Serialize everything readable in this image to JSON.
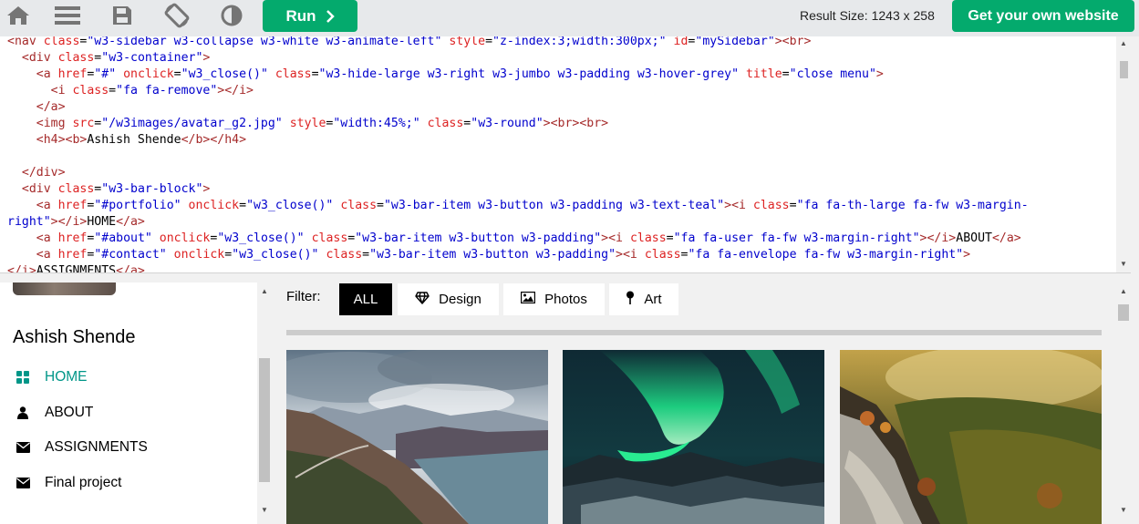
{
  "toolbar": {
    "icons": [
      "home-icon",
      "menu-icon",
      "save-icon",
      "rotate-icon",
      "theme-contrast-icon"
    ],
    "run_label": "Run",
    "result_size": "Result Size: 1243 x 258",
    "get_website_label": "Get your own website"
  },
  "code_lines": [
    [
      {
        "t": "tg",
        "v": "<nav "
      },
      {
        "t": "at",
        "v": "class"
      },
      {
        "t": "tx",
        "v": "="
      },
      {
        "t": "vl",
        "v": "\"w3-sidebar w3-collapse w3-white w3-animate-left\""
      },
      {
        "t": "tx",
        "v": " "
      },
      {
        "t": "at",
        "v": "style"
      },
      {
        "t": "tx",
        "v": "="
      },
      {
        "t": "vl",
        "v": "\"z-index:3;width:300px;\""
      },
      {
        "t": "tx",
        "v": " "
      },
      {
        "t": "at",
        "v": "id"
      },
      {
        "t": "tx",
        "v": "="
      },
      {
        "t": "vl",
        "v": "\"mySidebar\""
      },
      {
        "t": "tg",
        "v": "><br>"
      }
    ],
    [
      {
        "t": "tx",
        "v": "  "
      },
      {
        "t": "tg",
        "v": "<div "
      },
      {
        "t": "at",
        "v": "class"
      },
      {
        "t": "tx",
        "v": "="
      },
      {
        "t": "vl",
        "v": "\"w3-container\""
      },
      {
        "t": "tg",
        "v": ">"
      }
    ],
    [
      {
        "t": "tx",
        "v": "    "
      },
      {
        "t": "tg",
        "v": "<a "
      },
      {
        "t": "at",
        "v": "href"
      },
      {
        "t": "tx",
        "v": "="
      },
      {
        "t": "vl",
        "v": "\"#\""
      },
      {
        "t": "tx",
        "v": " "
      },
      {
        "t": "at",
        "v": "onclick"
      },
      {
        "t": "tx",
        "v": "="
      },
      {
        "t": "vl",
        "v": "\"w3_close()\""
      },
      {
        "t": "tx",
        "v": " "
      },
      {
        "t": "at",
        "v": "class"
      },
      {
        "t": "tx",
        "v": "="
      },
      {
        "t": "vl",
        "v": "\"w3-hide-large w3-right w3-jumbo w3-padding w3-hover-grey\""
      },
      {
        "t": "tx",
        "v": " "
      },
      {
        "t": "at",
        "v": "title"
      },
      {
        "t": "tx",
        "v": "="
      },
      {
        "t": "vl",
        "v": "\"close menu\""
      },
      {
        "t": "tg",
        "v": ">"
      }
    ],
    [
      {
        "t": "tx",
        "v": "      "
      },
      {
        "t": "tg",
        "v": "<i "
      },
      {
        "t": "at",
        "v": "class"
      },
      {
        "t": "tx",
        "v": "="
      },
      {
        "t": "vl",
        "v": "\"fa fa-remove\""
      },
      {
        "t": "tg",
        "v": "></i>"
      }
    ],
    [
      {
        "t": "tx",
        "v": "    "
      },
      {
        "t": "tg",
        "v": "</a>"
      }
    ],
    [
      {
        "t": "tx",
        "v": "    "
      },
      {
        "t": "tg",
        "v": "<img "
      },
      {
        "t": "at",
        "v": "src"
      },
      {
        "t": "tx",
        "v": "="
      },
      {
        "t": "vl",
        "v": "\"/w3images/avatar_g2.jpg\""
      },
      {
        "t": "tx",
        "v": " "
      },
      {
        "t": "at",
        "v": "style"
      },
      {
        "t": "tx",
        "v": "="
      },
      {
        "t": "vl",
        "v": "\"width:45%;\""
      },
      {
        "t": "tx",
        "v": " "
      },
      {
        "t": "at",
        "v": "class"
      },
      {
        "t": "tx",
        "v": "="
      },
      {
        "t": "vl",
        "v": "\"w3-round\""
      },
      {
        "t": "tg",
        "v": "><br><br>"
      }
    ],
    [
      {
        "t": "tx",
        "v": "    "
      },
      {
        "t": "tg",
        "v": "<h4><b>"
      },
      {
        "t": "tx",
        "v": "Ashish Shende"
      },
      {
        "t": "tg",
        "v": "</b></h4>"
      }
    ],
    [
      {
        "t": "tx",
        "v": ""
      }
    ],
    [
      {
        "t": "tx",
        "v": "  "
      },
      {
        "t": "tg",
        "v": "</div>"
      }
    ],
    [
      {
        "t": "tx",
        "v": "  "
      },
      {
        "t": "tg",
        "v": "<div "
      },
      {
        "t": "at",
        "v": "class"
      },
      {
        "t": "tx",
        "v": "="
      },
      {
        "t": "vl",
        "v": "\"w3-bar-block\""
      },
      {
        "t": "tg",
        "v": ">"
      }
    ],
    [
      {
        "t": "tx",
        "v": "    "
      },
      {
        "t": "tg",
        "v": "<a "
      },
      {
        "t": "at",
        "v": "href"
      },
      {
        "t": "tx",
        "v": "="
      },
      {
        "t": "vl",
        "v": "\"#portfolio\""
      },
      {
        "t": "tx",
        "v": " "
      },
      {
        "t": "at",
        "v": "onclick"
      },
      {
        "t": "tx",
        "v": "="
      },
      {
        "t": "vl",
        "v": "\"w3_close()\""
      },
      {
        "t": "tx",
        "v": " "
      },
      {
        "t": "at",
        "v": "class"
      },
      {
        "t": "tx",
        "v": "="
      },
      {
        "t": "vl",
        "v": "\"w3-bar-item w3-button w3-padding w3-text-teal\""
      },
      {
        "t": "tg",
        "v": "><i "
      },
      {
        "t": "at",
        "v": "class"
      },
      {
        "t": "tx",
        "v": "="
      },
      {
        "t": "vl",
        "v": "\"fa fa-th-large fa-fw w3-margin-"
      }
    ],
    [
      {
        "t": "vl",
        "v": "right\""
      },
      {
        "t": "tg",
        "v": "></i>"
      },
      {
        "t": "tx",
        "v": "HOME"
      },
      {
        "t": "tg",
        "v": "</a>"
      }
    ],
    [
      {
        "t": "tx",
        "v": "    "
      },
      {
        "t": "tg",
        "v": "<a "
      },
      {
        "t": "at",
        "v": "href"
      },
      {
        "t": "tx",
        "v": "="
      },
      {
        "t": "vl",
        "v": "\"#about\""
      },
      {
        "t": "tx",
        "v": " "
      },
      {
        "t": "at",
        "v": "onclick"
      },
      {
        "t": "tx",
        "v": "="
      },
      {
        "t": "vl",
        "v": "\"w3_close()\""
      },
      {
        "t": "tx",
        "v": " "
      },
      {
        "t": "at",
        "v": "class"
      },
      {
        "t": "tx",
        "v": "="
      },
      {
        "t": "vl",
        "v": "\"w3-bar-item w3-button w3-padding\""
      },
      {
        "t": "tg",
        "v": "><i "
      },
      {
        "t": "at",
        "v": "class"
      },
      {
        "t": "tx",
        "v": "="
      },
      {
        "t": "vl",
        "v": "\"fa fa-user fa-fw w3-margin-right\""
      },
      {
        "t": "tg",
        "v": "></i>"
      },
      {
        "t": "tx",
        "v": "ABOUT"
      },
      {
        "t": "tg",
        "v": "</a>"
      }
    ],
    [
      {
        "t": "tx",
        "v": "    "
      },
      {
        "t": "tg",
        "v": "<a "
      },
      {
        "t": "at",
        "v": "href"
      },
      {
        "t": "tx",
        "v": "="
      },
      {
        "t": "vl",
        "v": "\"#contact\""
      },
      {
        "t": "tx",
        "v": " "
      },
      {
        "t": "at",
        "v": "onclick"
      },
      {
        "t": "tx",
        "v": "="
      },
      {
        "t": "vl",
        "v": "\"w3_close()\""
      },
      {
        "t": "tx",
        "v": " "
      },
      {
        "t": "at",
        "v": "class"
      },
      {
        "t": "tx",
        "v": "="
      },
      {
        "t": "vl",
        "v": "\"w3-bar-item w3-button w3-padding\""
      },
      {
        "t": "tg",
        "v": "><i "
      },
      {
        "t": "at",
        "v": "class"
      },
      {
        "t": "tx",
        "v": "="
      },
      {
        "t": "vl",
        "v": "\"fa fa-envelope fa-fw w3-margin-right\""
      },
      {
        "t": "tg",
        "v": ">"
      }
    ],
    [
      {
        "t": "tg",
        "v": "</i>"
      },
      {
        "t": "tx",
        "v": "ASSIGNMENTS"
      },
      {
        "t": "tg",
        "v": "</a>"
      }
    ]
  ],
  "sidebar": {
    "name": "Ashish Shende",
    "items": [
      {
        "label": "HOME",
        "icon": "th-large-icon",
        "active": true
      },
      {
        "label": "ABOUT",
        "icon": "user-icon",
        "active": false
      },
      {
        "label": "ASSIGNMENTS",
        "icon": "envelope-icon",
        "active": false
      },
      {
        "label": "Final project",
        "icon": "envelope-icon",
        "active": false
      }
    ]
  },
  "filter": {
    "label": "Filter:",
    "buttons": [
      {
        "label": "ALL",
        "icon": "",
        "active": true
      },
      {
        "label": "Design",
        "icon": "diamond-icon",
        "active": false
      },
      {
        "label": "Photos",
        "icon": "photo-icon",
        "active": false
      },
      {
        "label": "Art",
        "icon": "map-pin-icon",
        "active": false
      }
    ]
  },
  "colors": {
    "accent_green": "#04aa6d",
    "teal": "#009688",
    "code_tag": "#a52a2a",
    "code_attr": "#dd2222",
    "code_value": "#0000cd"
  }
}
